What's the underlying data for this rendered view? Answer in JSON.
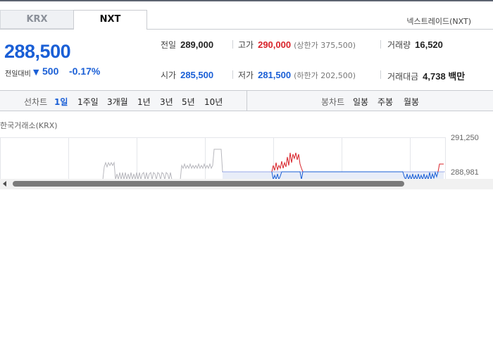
{
  "tabs": [
    {
      "label": "KRX",
      "active": false
    },
    {
      "label": "NXT",
      "active": true
    }
  ],
  "exchange_name": "넥스트레이드(NXT)",
  "price": {
    "current": "288,500",
    "change_label": "전일대비",
    "change_icon": "down-triangle-icon",
    "change_value": "500",
    "change_rate": "-0.17%"
  },
  "stats": {
    "prev_close": {
      "label": "전일",
      "value": "289,000"
    },
    "high": {
      "label": "고가",
      "value": "290,000",
      "sub": "(상한가 375,500)"
    },
    "volume": {
      "label": "거래량",
      "value": "16,520"
    },
    "open": {
      "label": "시가",
      "value": "285,500"
    },
    "low": {
      "label": "저가",
      "value": "281,500",
      "sub": "(하한가 202,500)"
    },
    "amount": {
      "label": "거래대금",
      "value": "4,738 백만"
    }
  },
  "line_chart": {
    "label": "선차트",
    "periods": [
      "1일",
      "1주일",
      "3개월",
      "1년",
      "3년",
      "5년",
      "10년"
    ],
    "active": "1일"
  },
  "candle_chart": {
    "label": "봉차트",
    "periods": [
      "일봉",
      "주봉",
      "월봉"
    ]
  },
  "chart_source": "한국거래소(KRX)",
  "chart_axis": {
    "top": "291,250",
    "reference": "288,981"
  },
  "colors": {
    "up": "#d8232a",
    "down": "#1a5fd6",
    "flat": "#b8b8be",
    "accent": "#1a5fd6"
  }
}
